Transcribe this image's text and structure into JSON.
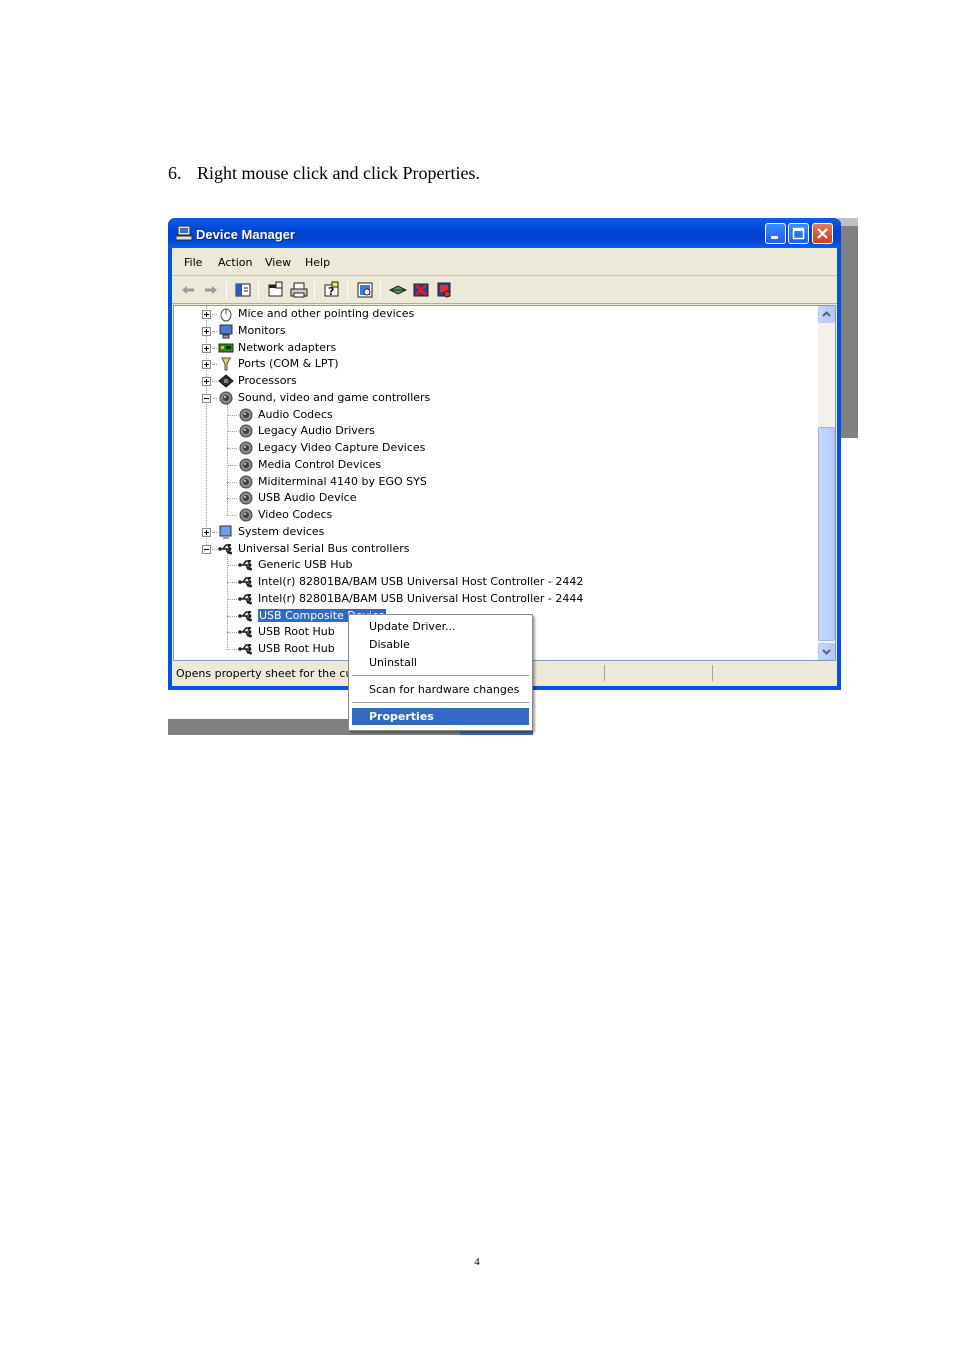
{
  "document": {
    "step_number": "6.",
    "step_text": "Right mouse click and click Properties.",
    "page_number": "4"
  },
  "window": {
    "title": "Device Manager",
    "icon": "computer-icon",
    "caption_buttons": [
      "minimize-icon",
      "maximize-icon",
      "close-icon"
    ]
  },
  "menubar": {
    "items": [
      "File",
      "Action",
      "View",
      "Help"
    ]
  },
  "toolbar": {
    "buttons": [
      "back-arrow-icon",
      "forward-arrow-icon",
      "console-tree-icon",
      "properties-icon",
      "print-icon",
      "help-icon",
      "scan-hardware-icon",
      "update-driver-icon",
      "disable-icon",
      "uninstall-icon"
    ]
  },
  "tree": {
    "items": [
      {
        "label": "Mice and other pointing devices",
        "icon": "mouse-icon",
        "expander": "plus"
      },
      {
        "label": "Monitors",
        "icon": "monitor-icon",
        "expander": "plus"
      },
      {
        "label": "Network adapters",
        "icon": "network-card-icon",
        "expander": "plus"
      },
      {
        "label": "Ports (COM & LPT)",
        "icon": "port-icon",
        "expander": "plus"
      },
      {
        "label": "Processors",
        "icon": "processor-icon",
        "expander": "plus"
      },
      {
        "label": "Sound, video and game controllers",
        "icon": "speaker-icon",
        "expander": "minus"
      },
      {
        "label": "Audio Codecs",
        "icon": "speaker-icon"
      },
      {
        "label": "Legacy Audio Drivers",
        "icon": "speaker-icon"
      },
      {
        "label": "Legacy Video Capture Devices",
        "icon": "speaker-icon"
      },
      {
        "label": "Media Control Devices",
        "icon": "speaker-icon"
      },
      {
        "label": "Miditerminal 4140 by EGO SYS",
        "icon": "speaker-icon"
      },
      {
        "label": "USB Audio Device",
        "icon": "speaker-icon"
      },
      {
        "label": "Video Codecs",
        "icon": "speaker-icon"
      },
      {
        "label": "System devices",
        "icon": "system-icon",
        "expander": "plus"
      },
      {
        "label": "Universal Serial Bus controllers",
        "icon": "usb-icon",
        "expander": "minus"
      },
      {
        "label": "Generic USB Hub",
        "icon": "usb-icon"
      },
      {
        "label": "Intel(r) 82801BA/BAM USB Universal Host Controller - 2442",
        "icon": "usb-icon"
      },
      {
        "label": "Intel(r) 82801BA/BAM USB Universal Host Controller - 2444",
        "icon": "usb-icon"
      },
      {
        "label": "USB Composite Device",
        "icon": "usb-icon",
        "selected": true
      },
      {
        "label": "USB Root Hub",
        "icon": "usb-icon"
      },
      {
        "label": "USB Root Hub",
        "icon": "usb-icon"
      }
    ]
  },
  "statusbar": {
    "text": "Opens property sheet for the curr"
  },
  "context_menu": {
    "update_driver": "Update Driver...",
    "disable": "Disable",
    "uninstall": "Uninstall",
    "scan": "Scan for hardware changes",
    "properties": "Properties"
  },
  "colors": {
    "titlebar": "#0054e3",
    "selection": "#316ac5",
    "window_face": "#ece9d8"
  }
}
